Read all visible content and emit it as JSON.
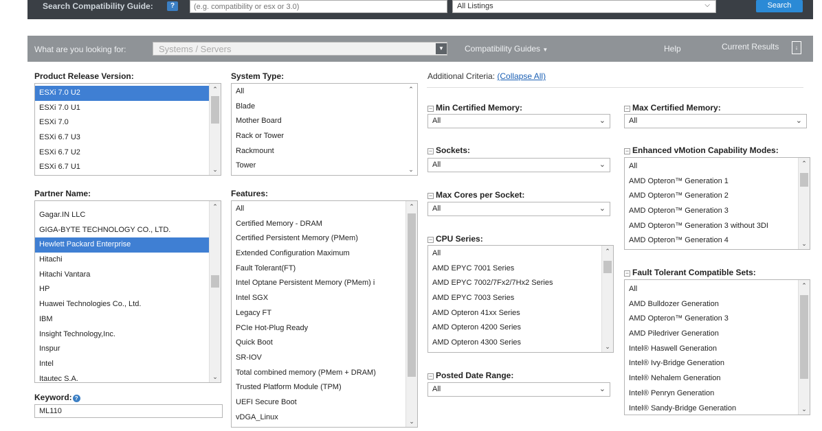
{
  "top": {
    "label": "Search Compatibility Guide:",
    "help": "?",
    "input_placeholder": "(e.g. compatibility or esx or 3.0)",
    "listing_select": "All Listings",
    "search_button": "Search"
  },
  "nav": {
    "question": "What are you looking for:",
    "selected": "Systems / Servers",
    "guides": "Compatibility Guides",
    "help": "Help",
    "current_results": "Current Results"
  },
  "release": {
    "label": "Product Release Version:",
    "options": [
      "ESXi 7.0 U2",
      "ESXi 7.0 U1",
      "ESXi 7.0",
      "ESXi 6.7 U3",
      "ESXi 6.7 U2",
      "ESXi 6.7 U1"
    ],
    "selected_index": 0
  },
  "system_type": {
    "label": "System Type:",
    "options": [
      "All",
      "Blade",
      "Mother Board",
      "Rack or Tower",
      "Rackmount",
      "Tower"
    ]
  },
  "partner": {
    "label": "Partner Name:",
    "options": [
      "Gagar.IN LLC",
      "GIGA-BYTE TECHNOLOGY CO., LTD.",
      "Hewlett Packard Enterprise",
      "Hitachi",
      "Hitachi Vantara",
      "HP",
      "Huawei Technologies Co., Ltd.",
      "IBM",
      "Insight Technology,Inc.",
      "Inspur",
      "Intel",
      "Itautec S.A."
    ],
    "selected_index": 2
  },
  "features": {
    "label": "Features:",
    "options": [
      "All",
      "Certified Memory - DRAM",
      "Certified Persistent Memory (PMem)",
      "Extended Configuration Maximum",
      "Fault Tolerant(FT)",
      "Intel Optane Persistent Memory (PMem) i",
      "Intel SGX",
      "Legacy FT",
      "PCIe Hot-Plug Ready",
      "Quick Boot",
      "SR-IOV",
      "Total combined memory (PMem + DRAM)",
      "Trusted Platform Module (TPM)",
      "UEFI Secure Boot",
      "vDGA_Linux"
    ]
  },
  "keyword": {
    "label": "Keyword:",
    "value": "ML110"
  },
  "additional": {
    "label": "Additional Criteria:",
    "collapse_link": "(Collapse All)"
  },
  "min_mem": {
    "label": "Min Certified Memory:",
    "value": "All"
  },
  "max_mem": {
    "label": "Max Certified Memory:",
    "value": "All"
  },
  "sockets": {
    "label": "Sockets:",
    "value": "All"
  },
  "evc": {
    "label": "Enhanced vMotion Capability Modes:",
    "options": [
      "All",
      "AMD Opteron™ Generation 1",
      "AMD Opteron™ Generation 2",
      "AMD Opteron™ Generation 3",
      "AMD Opteron™ Generation 3 without 3DI",
      "AMD Opteron™ Generation 4"
    ]
  },
  "max_cores": {
    "label": "Max Cores per Socket:",
    "value": "All"
  },
  "cpu_series": {
    "label": "CPU Series:",
    "options": [
      "All",
      "AMD EPYC 7001 Series",
      "AMD EPYC 7002/7Fx2/7Hx2 Series",
      "AMD EPYC 7003 Series",
      "AMD Opteron 41xx Series",
      "AMD Opteron 4200 Series",
      "AMD Opteron 4300 Series"
    ]
  },
  "ft_sets": {
    "label": "Fault Tolerant Compatible Sets:",
    "options": [
      "All",
      "AMD Bulldozer Generation",
      "AMD Opteron™ Generation 3",
      "AMD Piledriver Generation",
      "Intel® Haswell Generation",
      "Intel® Ivy-Bridge Generation",
      "Intel® Nehalem Generation",
      "Intel® Penryn Generation",
      "Intel® Sandy-Bridge Generation"
    ]
  },
  "posted_date": {
    "label": "Posted Date Range:",
    "value": "All"
  }
}
